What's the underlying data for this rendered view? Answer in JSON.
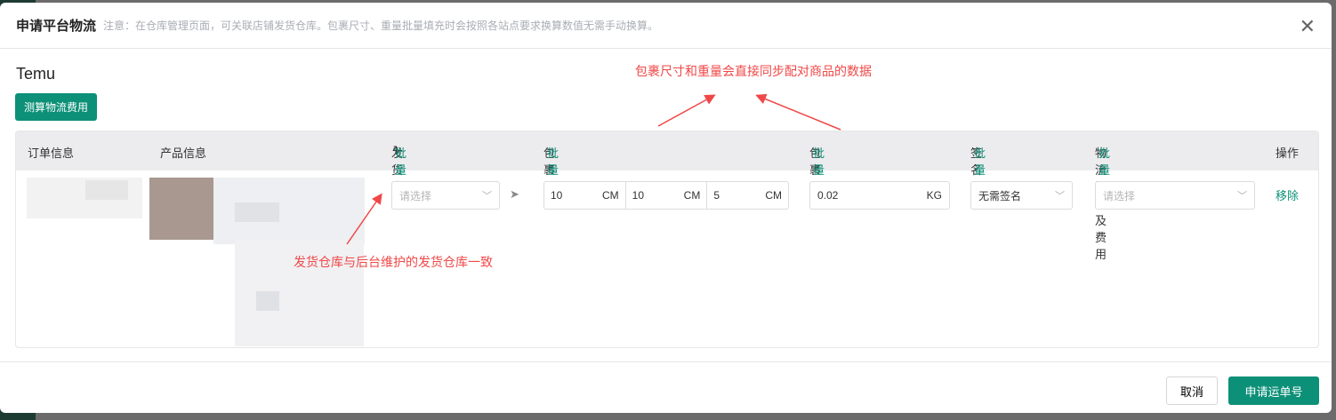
{
  "dialog": {
    "title": "申请平台物流",
    "notice": "注意：在仓库管理页面，可关联店铺发货仓库。包裹尺寸、重量批量填充时会按照各站点要求换算数值无需手动换算。",
    "close": "✕"
  },
  "store": "Temu",
  "calc_button": "测算物流费用",
  "table": {
    "headers": {
      "order": "订单信息",
      "product": "产品信息",
      "warehouse": "发货仓库",
      "size": "包裹尺寸",
      "weight": "包裹重量",
      "sign": "签名服务",
      "channel": "物流渠道及费用",
      "action": "操作"
    },
    "batch": "批量",
    "row": {
      "warehouse_placeholder": "请选择",
      "length": "10",
      "width": "10",
      "height": "5",
      "size_unit": "CM",
      "weight": "0.02",
      "weight_unit": "KG",
      "sign": "无需签名",
      "channel_placeholder": "请选择",
      "remove": "移除"
    }
  },
  "annotations": {
    "top": "包裹尺寸和重量会直接同步配对商品的数据",
    "warehouse": "发货仓库与后台维护的发货仓库一致"
  },
  "footer": {
    "cancel": "取消",
    "apply": "申请运单号"
  },
  "colors": {
    "accent": "#0d9078",
    "annotation": "#f04848"
  }
}
